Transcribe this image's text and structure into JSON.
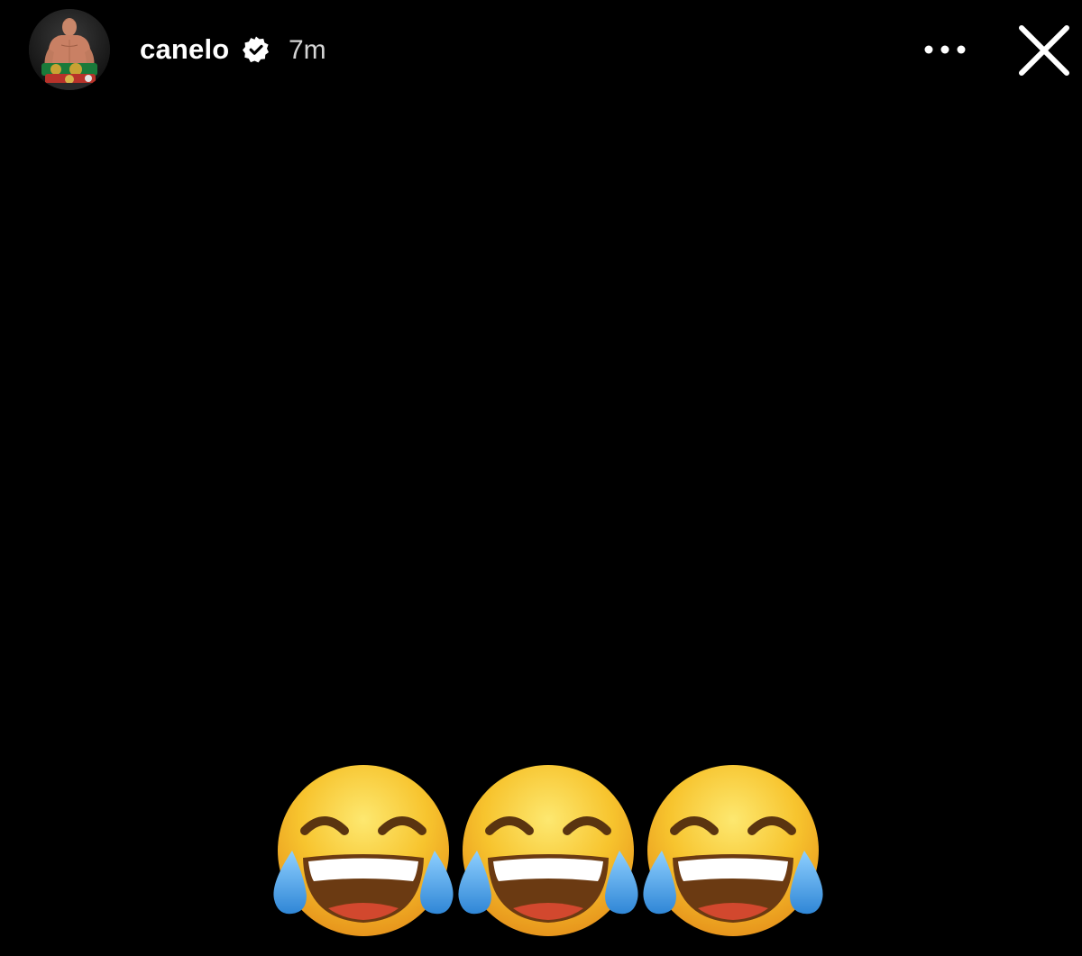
{
  "story": {
    "username": "canelo",
    "verified": true,
    "timestamp": "7m",
    "avatar_icon": "profile-photo-boxer-with-belts",
    "more_icon": "more-horizontal-icon",
    "close_icon": "close-icon"
  },
  "content": {
    "background_color": "#000000",
    "emojis": [
      "face-with-tears-of-joy",
      "face-with-tears-of-joy",
      "face-with-tears-of-joy"
    ]
  },
  "colors": {
    "text": "#ffffff",
    "timestamp": "#d4d4d4",
    "emoji_face": "#f6c22d",
    "emoji_tears": "#4aa3e8"
  }
}
